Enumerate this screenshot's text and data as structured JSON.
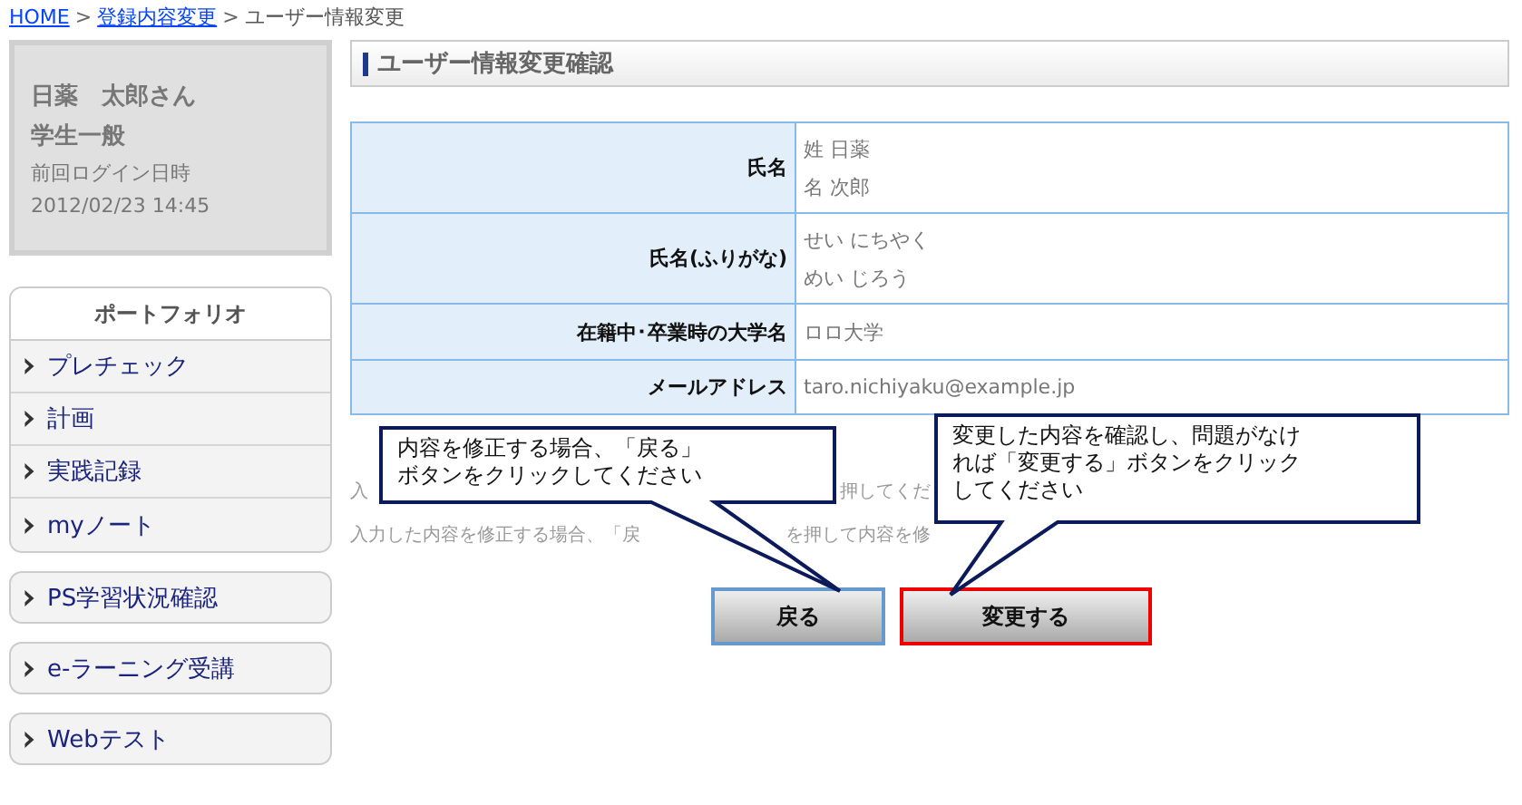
{
  "breadcrumb_separator": ">",
  "breadcrumb": [
    {
      "label": "HOME",
      "link": true
    },
    {
      "label": "登録内容変更",
      "link": true
    },
    {
      "label": "ユーザー情報変更",
      "link": false
    }
  ],
  "profile": {
    "name": "日薬　太郎さん",
    "role": "学生一般",
    "last_login_label": "前回ログイン日時",
    "last_login": "2012/02/23 14:45"
  },
  "sidebar": {
    "portfolio_title": "ポートフォリオ",
    "portfolio_items": [
      "プレチェック",
      "計画",
      "実践記録",
      "myノート"
    ],
    "items": [
      "PS学習状況確認",
      "e-ラーニング受講",
      "Webテスト"
    ]
  },
  "heading": "ユーザー情報変更確認",
  "table": {
    "rows": [
      {
        "label": "氏名",
        "values": [
          "姓  日薬",
          "名  次郎"
        ]
      },
      {
        "label": "氏名(ふりがな)",
        "values": [
          "せい  にちやく",
          "めい  じろう"
        ]
      },
      {
        "label": "在籍中･卒業時の大学名",
        "values": [
          "ロロ大学"
        ]
      },
      {
        "label": "メールアドレス",
        "values": [
          "taro.nichiyaku@example.jp"
        ]
      }
    ]
  },
  "notes": [
    [
      "入",
      "押してくだ"
    ],
    [
      "入力した内容を修正する場合、「戻",
      "を押して内容を修"
    ]
  ],
  "buttons": [
    {
      "label": "戻る",
      "color": "#6699cc"
    },
    {
      "label": "変更する",
      "color": "#ee0000"
    }
  ],
  "callouts": [
    {
      "lines": [
        "内容を修正する場合、「戻る」",
        "ボタンをクリックしてください"
      ]
    },
    {
      "lines": [
        "変更した内容を確認し、問題がなけ",
        "れば「変更する」ボタンをクリック",
        "してください"
      ]
    }
  ]
}
